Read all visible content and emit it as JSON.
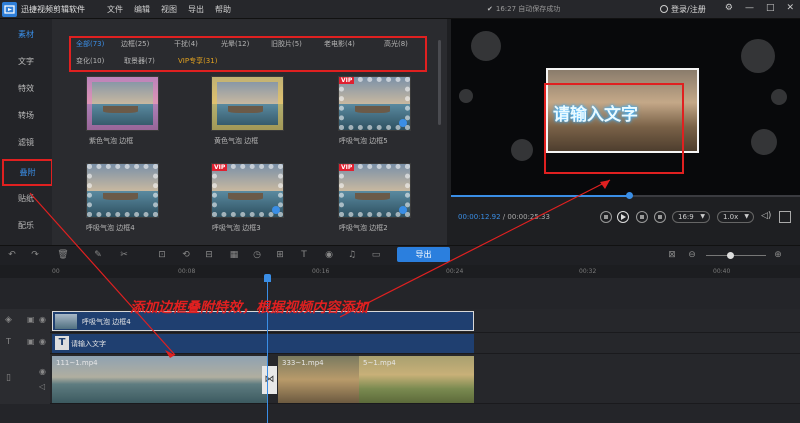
{
  "app": {
    "title": "迅捷视频剪辑软件",
    "menu": [
      "文件",
      "编辑",
      "视图",
      "导出",
      "帮助"
    ],
    "save_status": "16:27 自动保存成功",
    "login": "登录/注册"
  },
  "leftnav": [
    "素材",
    "文字",
    "特效",
    "转场",
    "滤镜",
    "叠附",
    "贴纸",
    "配乐"
  ],
  "categories": [
    "全部(73)",
    "边框(25)",
    "干扰(4)",
    "光晕(12)",
    "旧胶片(5)",
    "老电影(4)",
    "高光(8)",
    "变化(10)",
    "取景器(7)",
    "VIP专享(31)"
  ],
  "thumbnails": [
    {
      "label": "紫色气泡 边框",
      "vip": "",
      "frame": "pink"
    },
    {
      "label": "黄色气泡 边框",
      "vip": "",
      "frame": "gold"
    },
    {
      "label": "呼吸气泡 边框5",
      "vip": "VIP",
      "frame": "bubble"
    },
    {
      "label": "呼吸气泡 边框4",
      "vip": "",
      "frame": "bubble"
    },
    {
      "label": "呼吸气泡 边框3",
      "vip": "VIP",
      "frame": "bubble"
    },
    {
      "label": "呼吸气泡 边框2",
      "vip": "VIP",
      "frame": "bubble"
    }
  ],
  "preview": {
    "overlay_text": "请输入文字",
    "current_time": "00:00:12.92",
    "total_time": "00:00:25.33",
    "progress": 0.51,
    "aspect": "16:9",
    "speed": "1.0x"
  },
  "toolbar": {
    "export_label": "导出"
  },
  "ruler": [
    "00",
    "00:08",
    "00:16",
    "00:24",
    "00:32",
    "00:40"
  ],
  "timeline": {
    "overlay_clip": "呼吸气泡 边框4",
    "text_clip": "请输入文字",
    "video_clips": [
      "111~1.mp4",
      "333~1.mp4",
      "5~1.mp4"
    ]
  },
  "annotation": "添加边框叠附特效，根据视频内容添加",
  "colors": {
    "accent": "#3a8ee6",
    "highlight": "#e02020",
    "vip": "#e0a020"
  }
}
